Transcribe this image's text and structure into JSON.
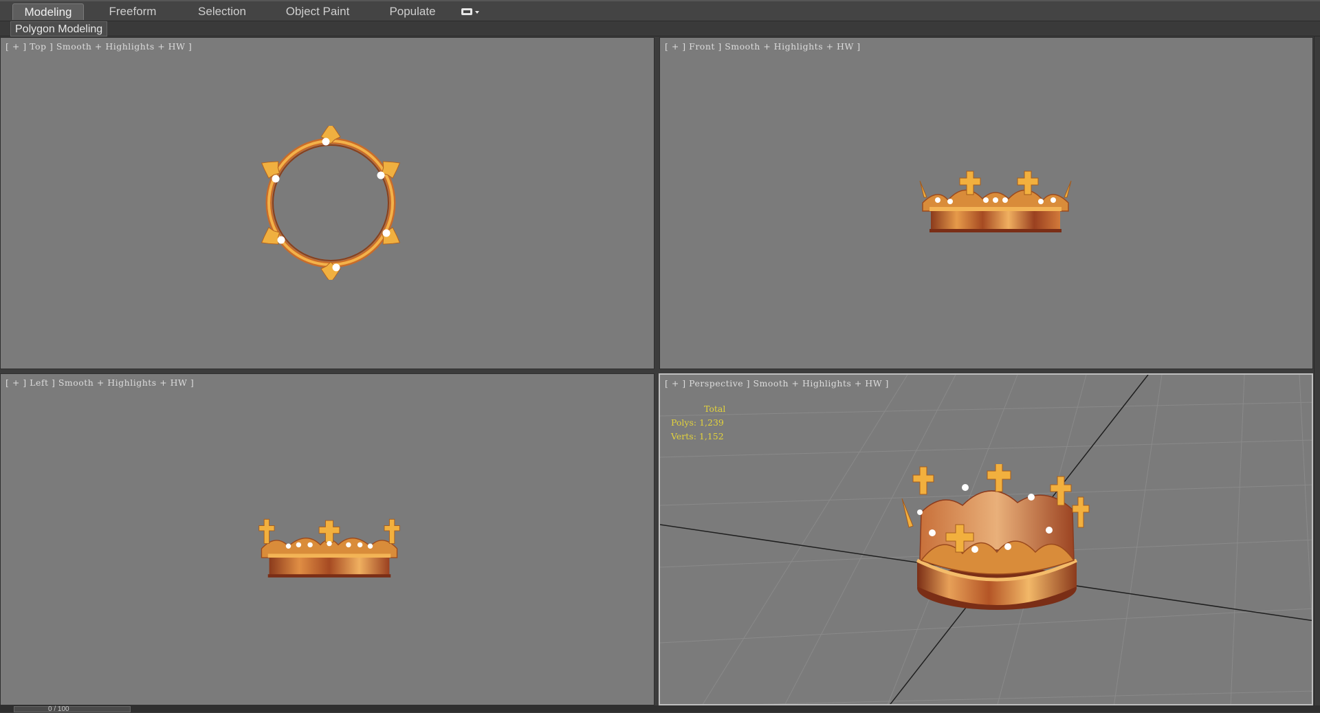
{
  "ribbon": {
    "tabs": [
      {
        "label": "Modeling",
        "active": true
      },
      {
        "label": "Freeform",
        "active": false
      },
      {
        "label": "Selection",
        "active": false
      },
      {
        "label": "Object Paint",
        "active": false
      },
      {
        "label": "Populate",
        "active": false
      }
    ],
    "menu_icon": "window-dropdown-icon",
    "sub_panel_label": "Polygon Modeling"
  },
  "viewports": {
    "top": {
      "label": "[ + ] Top ] Smooth + Highlights + HW ]",
      "view": "Top"
    },
    "front": {
      "label": "[ + ] Front ] Smooth + Highlights + HW ]",
      "view": "Front"
    },
    "left": {
      "label": "[ + ] Left ] Smooth + Highlights + HW ]",
      "view": "Left"
    },
    "perspective": {
      "label": "[ + ] Perspective ] Smooth + Highlights + HW ]",
      "view": "Perspective",
      "stats": {
        "title": "Total",
        "polys": "Polys: 1,239",
        "verts": "Verts: 1,152"
      }
    }
  },
  "timeline": {
    "frame_text": "0 / 100"
  },
  "colors": {
    "viewport_bg": "#7b7b7b",
    "ui_bg": "#3c3c3c",
    "gold": "#e9a53a",
    "copper": "#b8582a",
    "stats_yellow": "#e2d23c"
  }
}
